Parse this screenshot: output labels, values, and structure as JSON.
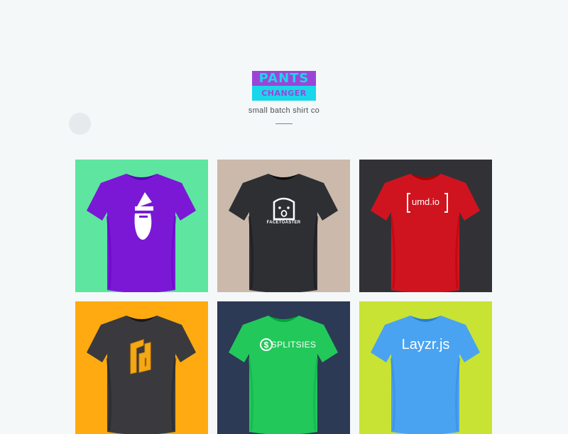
{
  "brand": {
    "logo_top": "PANTS",
    "logo_bottom": "CHANGER",
    "tagline": "small batch shirt co"
  },
  "colors": {
    "background": "#f5f8f9",
    "logo_purple": "#9b45d8",
    "logo_cyan": "#19d6ea"
  },
  "products": [
    {
      "id": "wizard",
      "tile_color": "#5ee5a0",
      "shirt_color": "#7a18d6",
      "icon": "wizard-icon",
      "label": ""
    },
    {
      "id": "facetoaster",
      "tile_color": "#cbb9ab",
      "shirt_color": "#2d2f33",
      "icon": "toaster-icon",
      "label": "FACETOASTER"
    },
    {
      "id": "umd",
      "tile_color": "#323236",
      "shirt_color": "#cf1420",
      "icon": "brackets-icon",
      "label": "umd.io"
    },
    {
      "id": "rb",
      "tile_color": "#ffaa10",
      "shirt_color": "#3a3a3e",
      "icon": "rb-monogram-icon",
      "label": ""
    },
    {
      "id": "splitsies",
      "tile_color": "#2c3a55",
      "shirt_color": "#23c85a",
      "icon": "dollar-circle-icon",
      "label": "SPLITSIES"
    },
    {
      "id": "layzr",
      "tile_color": "#c9e334",
      "shirt_color": "#4aa3f0",
      "icon": "none",
      "label": "Layzr.js"
    }
  ]
}
